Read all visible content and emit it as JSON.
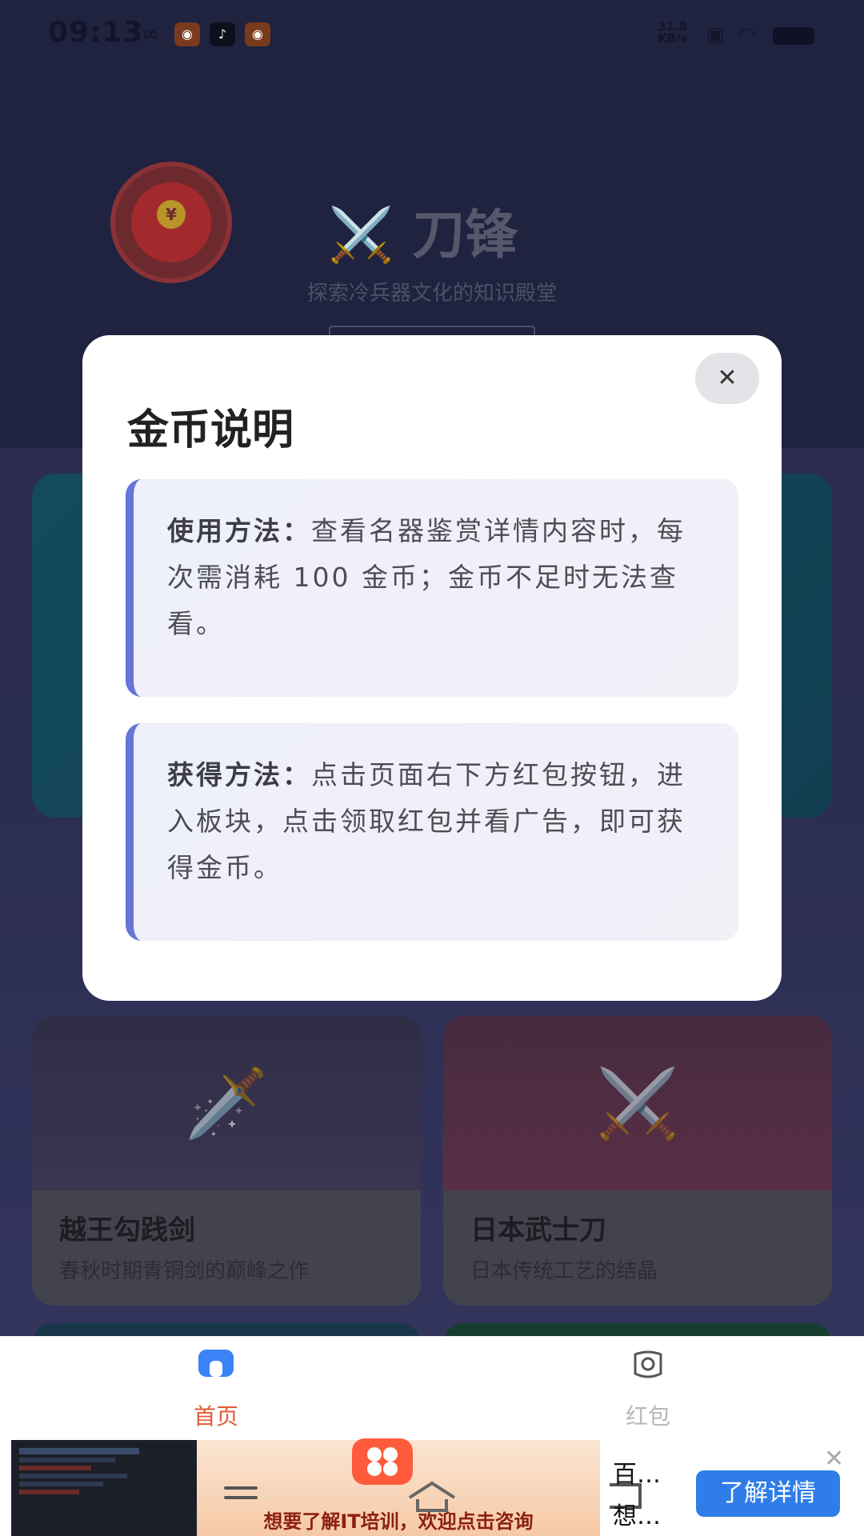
{
  "status_bar": {
    "time": "09:13",
    "speed_value": "31.8",
    "speed_unit": "KB/s"
  },
  "hero": {
    "title": "⚔️ 刀锋",
    "subtitle": "探索冷兵器文化的知识殿堂"
  },
  "modal": {
    "title": "金币说明",
    "close_glyph": "✕",
    "sections": [
      {
        "label": "使用方法：",
        "text": "查看名器鉴赏详情内容时，每次需消耗 100 金币；金币不足时无法查看。"
      },
      {
        "label": "获得方法：",
        "text": "点击页面右下方红包按钮，进入板块，点击领取红包并看广告，即可获得金币。"
      }
    ]
  },
  "cards": [
    {
      "title": "越王勾践剑",
      "desc": "春秋时期青铜剑的巅峰之作",
      "icon": "🗡️",
      "color": "#3a3550"
    },
    {
      "title": "日本武士刀",
      "desc": "日本传统工艺的结晶",
      "icon": "⚔️",
      "color": "#5a2f46"
    }
  ],
  "tabbar": {
    "tabs": [
      {
        "label": "首页",
        "active": true,
        "color": "#e35b36"
      },
      {
        "label": "红包",
        "active": false,
        "color": "#b8b8bd"
      }
    ]
  },
  "ad": {
    "slogan": "想要了解IT培训，欢迎点击咨询",
    "text_line1": "百…",
    "text_line2": "想…",
    "cta": "了解详情",
    "close_glyph": "✕"
  },
  "colors": {
    "accent": "#e35b36",
    "modal_border": "#6675d6",
    "cta": "#2f7de8"
  }
}
